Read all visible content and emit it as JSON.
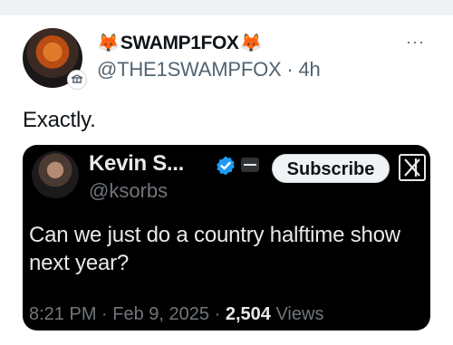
{
  "post": {
    "author": {
      "emoji_left": "🦊",
      "display_name": "SWAMP1FOX",
      "emoji_right": "🦊",
      "handle": "@THE1SWAMPFOX",
      "separator": "·",
      "time_ago": "4h",
      "avatar_icon": "fox-avatar-icon",
      "badge_icon": "government-badge-icon"
    },
    "more_label": "···",
    "text": "Exactly.",
    "quoted": {
      "display_name": "Kevin S...",
      "handle": "@ksorbs",
      "subscribe_label": "Subscribe",
      "verified_color": "#1d9bf0",
      "text": "Can we just do a country halftime show next year?",
      "time": "8:21 PM",
      "sep1": "·",
      "date": "Feb 9, 2025",
      "sep2": "·",
      "views_count": "2,504",
      "views_label": "Views"
    }
  },
  "colors": {
    "background": "#ffffff",
    "text": "#0f1419",
    "muted": "#536471",
    "card_background": "#000000",
    "card_text": "#e7e9ea",
    "card_muted": "#71767b"
  }
}
